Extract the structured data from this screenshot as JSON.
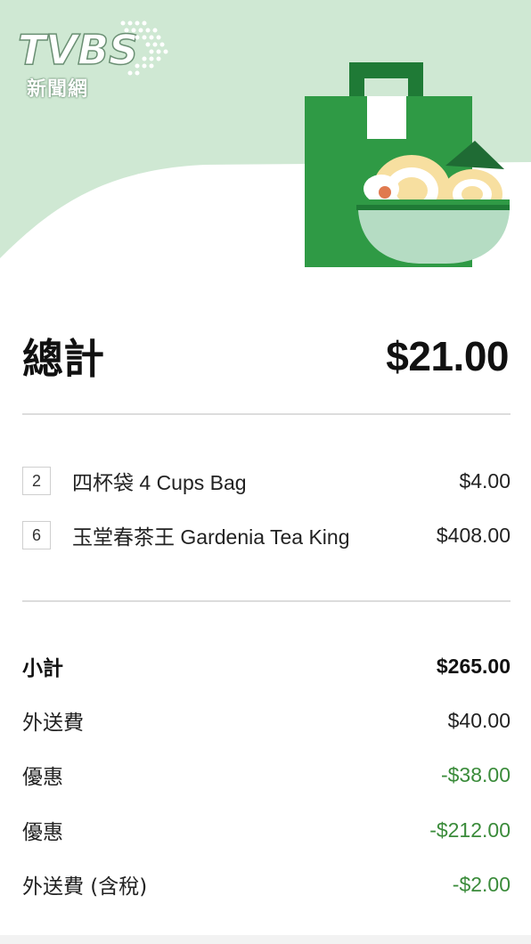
{
  "watermark": {
    "brand": "TVBS",
    "subtitle": "新聞網"
  },
  "colors": {
    "hero_bg": "#cfe8d3",
    "bag_green": "#2f9a45",
    "bag_dark": "#1f7a36",
    "bowl": "#b5dcc3",
    "discount_green": "#3a8b3a"
  },
  "order": {
    "total_label": "總計",
    "total_value": "$21.00",
    "items": [
      {
        "qty": "2",
        "name": "四杯袋 4 Cups Bag",
        "price": "$4.00"
      },
      {
        "qty": "6",
        "name": "玉堂春茶王 Gardenia Tea King",
        "price": "$408.00"
      }
    ],
    "fees": [
      {
        "label": "小計",
        "value": "$265.00",
        "emphasis": true
      },
      {
        "label": "外送費",
        "value": "$40.00"
      },
      {
        "label": "優惠",
        "value": "-$38.00",
        "discount": true
      },
      {
        "label": "優惠",
        "value": "-$212.00",
        "discount": true
      },
      {
        "label": "外送費 (含稅)",
        "value": "-$2.00",
        "discount": true
      }
    ]
  }
}
